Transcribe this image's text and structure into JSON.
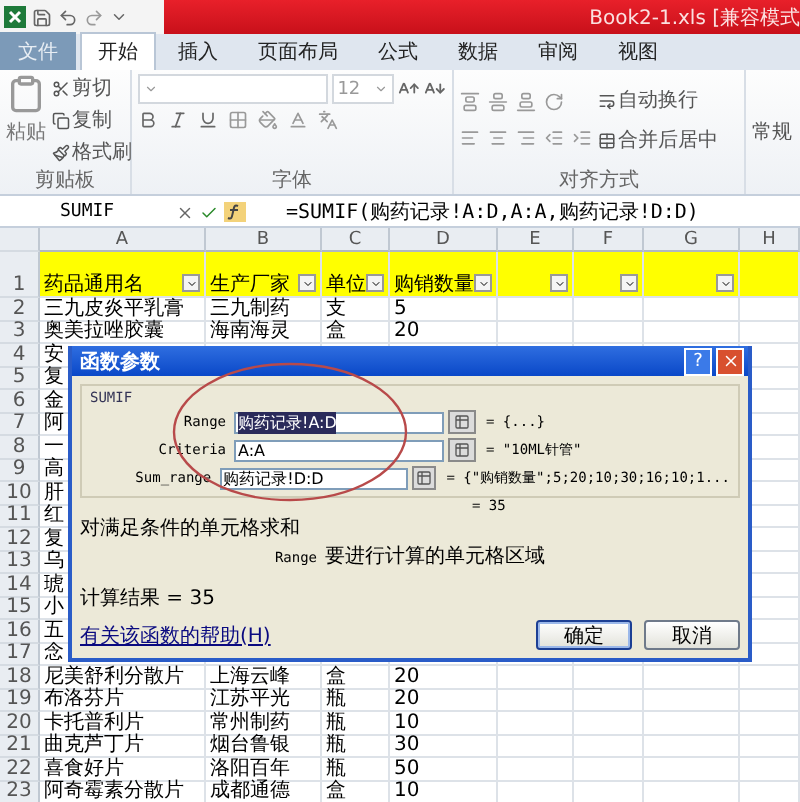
{
  "window": {
    "title": "Book2-1.xls  [兼容模式"
  },
  "tabs": [
    {
      "label": "文件",
      "kind": "file",
      "selected": false
    },
    {
      "label": "开始",
      "kind": "tab",
      "selected": true
    },
    {
      "label": "插入",
      "kind": "tab",
      "selected": false
    },
    {
      "label": "页面布局",
      "kind": "tab",
      "selected": false
    },
    {
      "label": "公式",
      "kind": "tab",
      "selected": false
    },
    {
      "label": "数据",
      "kind": "tab",
      "selected": false
    },
    {
      "label": "审阅",
      "kind": "tab",
      "selected": false
    },
    {
      "label": "视图",
      "kind": "tab",
      "selected": false
    }
  ],
  "ribbon": {
    "clipboard": {
      "paste": "粘贴",
      "cut": "剪切",
      "copy": "复制",
      "format_painter": "格式刷",
      "label": "剪贴板"
    },
    "font": {
      "size": "12",
      "label": "字体"
    },
    "alignment": {
      "wrap": "自动换行",
      "merge": "合并后居中",
      "label": "对齐方式"
    },
    "number": {
      "format": "常规"
    }
  },
  "formula_bar": {
    "name_box": "SUMIF",
    "formula": "=SUMIF(购药记录!A:D,A:A,购药记录!D:D)"
  },
  "columns": [
    "A",
    "B",
    "C",
    "D",
    "E",
    "F",
    "G",
    "H"
  ],
  "header_row": {
    "number": "1",
    "cells": [
      {
        "text": "药品通用名",
        "filter": true
      },
      {
        "text": "生产厂家",
        "filter": true
      },
      {
        "text": "单位",
        "filter": true
      },
      {
        "text": "购销数量",
        "filter": true
      },
      {
        "text": "",
        "filter": true
      },
      {
        "text": "",
        "filter": true
      },
      {
        "text": "",
        "filter": true
      },
      {
        "text": "",
        "filter": false
      }
    ]
  },
  "rows": [
    {
      "number": "2",
      "cells": [
        "三九皮炎平乳膏",
        "三九制药",
        "支",
        "5"
      ]
    },
    {
      "number": "3",
      "cells": [
        "奥美拉唑胶囊",
        "海南海灵",
        "盒",
        "20"
      ]
    },
    {
      "number": "4",
      "cells": [
        "安"
      ]
    },
    {
      "number": "5",
      "cells": [
        "复"
      ]
    },
    {
      "number": "6",
      "cells": [
        "金"
      ]
    },
    {
      "number": "7",
      "cells": [
        "阿"
      ]
    },
    {
      "number": "8",
      "cells": [
        "一"
      ]
    },
    {
      "number": "9",
      "cells": [
        "高"
      ]
    },
    {
      "number": "10",
      "cells": [
        "肝"
      ]
    },
    {
      "number": "11",
      "cells": [
        "红"
      ]
    },
    {
      "number": "12",
      "cells": [
        "复"
      ]
    },
    {
      "number": "13",
      "cells": [
        "乌"
      ]
    },
    {
      "number": "14",
      "cells": [
        "琥"
      ]
    },
    {
      "number": "15",
      "cells": [
        "小"
      ]
    },
    {
      "number": "16",
      "cells": [
        "五"
      ]
    },
    {
      "number": "17",
      "cells": [
        "念"
      ]
    },
    {
      "number": "18",
      "cells": [
        "尼美舒利分散片",
        "上海云峰",
        "盒",
        "20"
      ]
    },
    {
      "number": "19",
      "cells": [
        "布洛芬片",
        "江苏平光",
        "瓶",
        "20"
      ]
    },
    {
      "number": "20",
      "cells": [
        "卡托普利片",
        "常州制药",
        "瓶",
        "10"
      ]
    },
    {
      "number": "21",
      "cells": [
        "曲克芦丁片",
        "烟台鲁银",
        "瓶",
        "30"
      ]
    },
    {
      "number": "22",
      "cells": [
        "喜食好片",
        "洛阳百年",
        "瓶",
        "50"
      ]
    },
    {
      "number": "23",
      "cells": [
        "阿奇霉素分散片",
        "成都通德",
        "盒",
        "10"
      ]
    }
  ],
  "dialog": {
    "title": "函数参数",
    "help": "?",
    "function": "SUMIF",
    "args": [
      {
        "label": "Range",
        "value": "购药记录!A:D",
        "selected": true,
        "result": "= {...}"
      },
      {
        "label": "Criteria",
        "value": "A:A",
        "selected": false,
        "result": "= \"10ML针管\""
      },
      {
        "label": "Sum_range",
        "value": "购药记录!D:D",
        "selected": false,
        "result": "= {\"购销数量\";5;20;10;30;16;10;1..."
      }
    ],
    "total": "= 35",
    "description": "对满足条件的单元格求和",
    "arg_help": {
      "name": "Range",
      "text": "要进行计算的单元格区域"
    },
    "result": "计算结果 = 35",
    "help_link": "有关该函数的帮助(H)",
    "buttons": [
      {
        "label": "确定",
        "default": true
      },
      {
        "label": "取消",
        "default": false
      }
    ]
  }
}
